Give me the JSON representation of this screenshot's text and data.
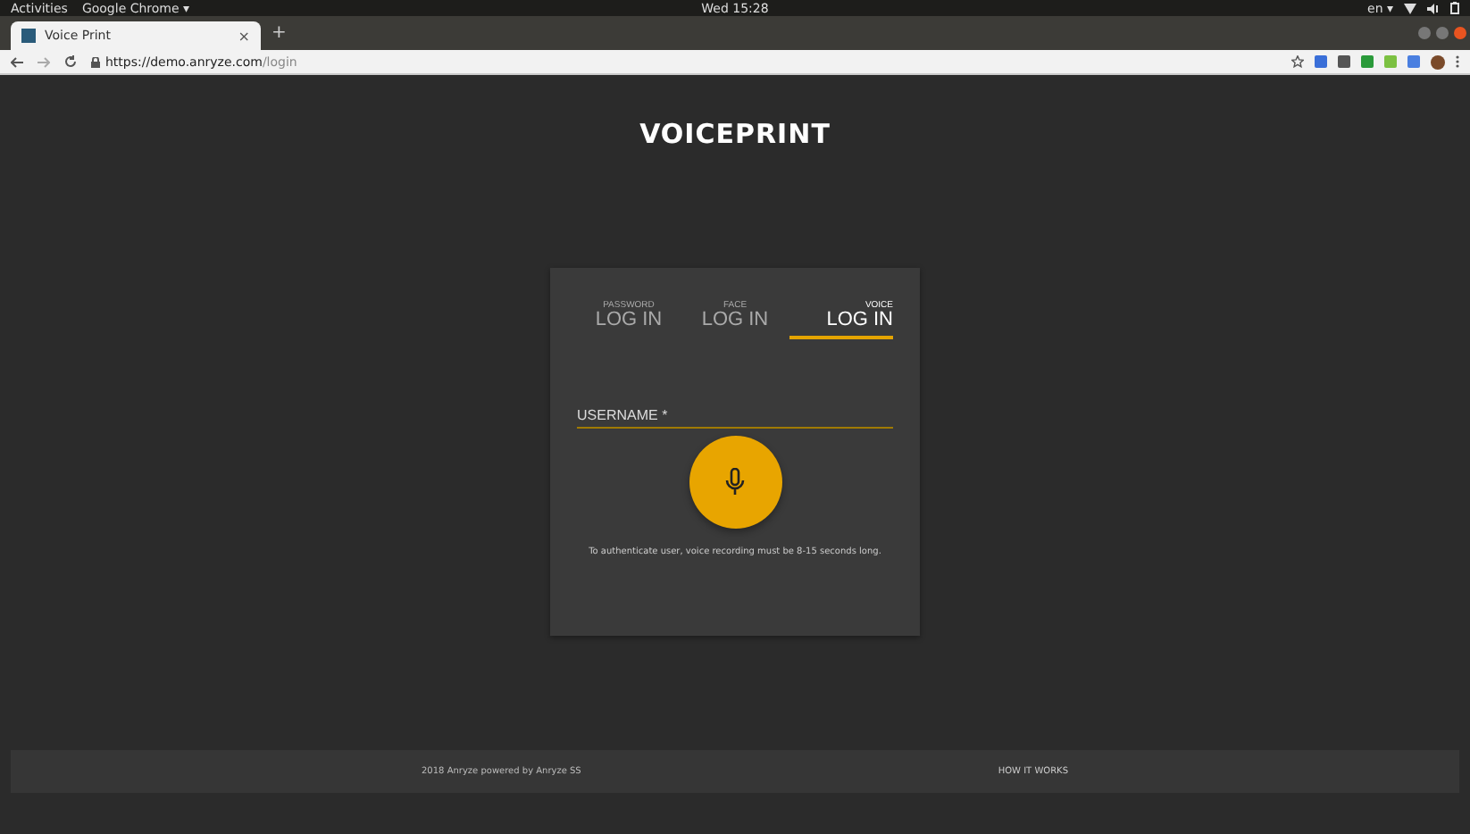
{
  "system_bar": {
    "activities": "Activities",
    "app": "Google Chrome ▾",
    "clock": "Wed 15:28",
    "language": "en ▾"
  },
  "browser": {
    "tab_title": "Voice Print",
    "tab_close": "×",
    "new_tab": "+",
    "url_host": "https://demo.anryze.com",
    "url_path": "/login"
  },
  "page": {
    "logo": "VOICEPRINT",
    "login_tabs": [
      {
        "caption": "PASSWORD",
        "label": "LOG IN",
        "selected": false
      },
      {
        "caption": "FACE",
        "label": "LOG IN",
        "selected": false
      },
      {
        "caption": "VOICE",
        "label": "LOG IN",
        "selected": true
      }
    ],
    "username": {
      "placeholder": "USERNAME *"
    },
    "hint": "To authenticate user, voice recording must be 8-15 seconds long.",
    "footer": {
      "copyright": "2018 Anryze powered by Anryze SS",
      "link": "HOW IT WORKS"
    }
  }
}
